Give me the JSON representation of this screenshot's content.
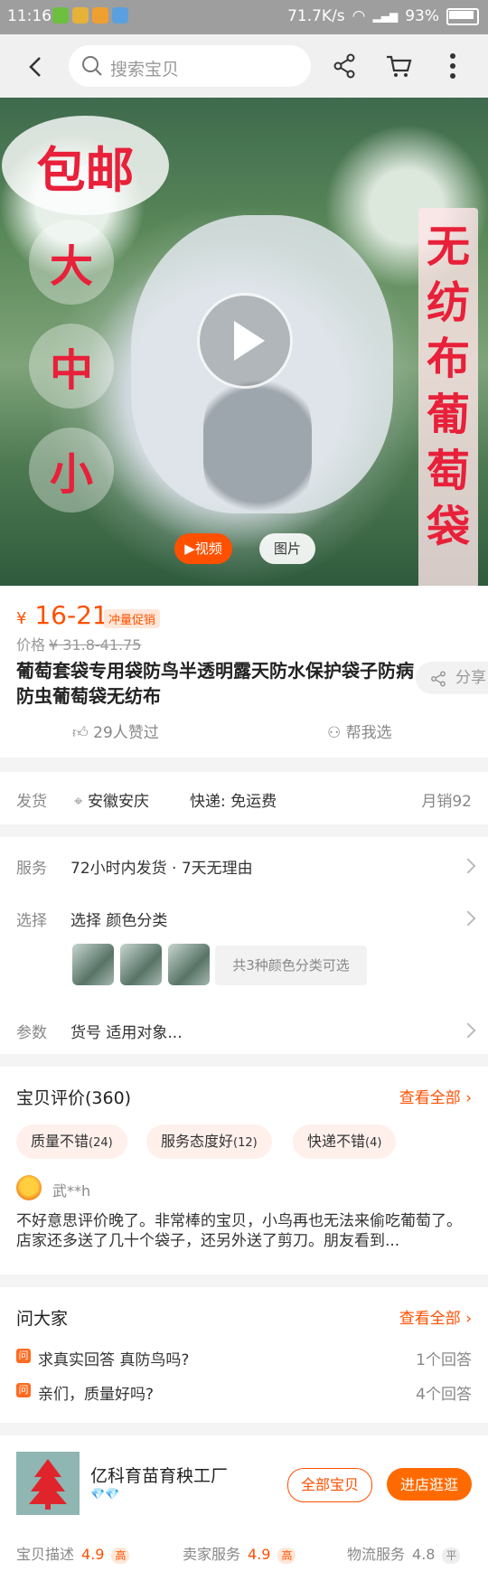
{
  "status": {
    "time": "11:16",
    "network": "71.7K/s",
    "battery": "93%"
  },
  "search": {
    "placeholder": "搜索宝贝"
  },
  "hero": {
    "badge": "包邮",
    "sizes": [
      "大",
      "中",
      "小"
    ],
    "vertical_banner": "无纺布葡萄袋",
    "video_label": "▶视频",
    "pic_label": "图片"
  },
  "product": {
    "price_symbol": "¥",
    "price": "16-21",
    "promo": "冲量促销",
    "old_price_label": "价格",
    "old_price": "¥ 31.8-41.75",
    "title": "葡萄套袋专用袋防鸟半透明露天防水保护袋子防病防虫葡萄袋无纺布",
    "share_label": "分享",
    "likes": "29人赞过",
    "help": "帮我选"
  },
  "shipping": {
    "label": "发货",
    "location": "安徽安庆",
    "express": "快递: 免运费",
    "sales": "月销92"
  },
  "service": {
    "service_label": "服务",
    "service_value": "72小时内发货 · 7天无理由",
    "choose_label": "选择",
    "choose_value": "选择 颜色分类",
    "color_note": "共3种颜色分类可选",
    "param_label": "参数",
    "param_value": "货号 适用对象..."
  },
  "review": {
    "title": "宝贝评价(360)",
    "see_all": "查看全部",
    "tags": [
      {
        "text": "质量不错",
        "count": "(24)"
      },
      {
        "text": "服务态度好",
        "count": "(12)"
      },
      {
        "text": "快递不错",
        "count": "(4)"
      }
    ],
    "reviewer": "武**h",
    "text": "不好意思评价晚了。非常棒的宝贝，小鸟再也无法来偷吃葡萄了。店家还多送了几十个袋子，还另外送了剪刀。朋友看到..."
  },
  "ask": {
    "title": "问大家",
    "see_all": "查看全部",
    "icon": "问",
    "questions": [
      {
        "q": "求真实回答 真防鸟吗?",
        "a": "1个回答"
      },
      {
        "q": "亲们，质量好吗?",
        "a": "4个回答"
      }
    ]
  },
  "shop": {
    "name": "亿科育苗育秧工厂",
    "all_button": "全部宝贝",
    "enter_button": "进店逛逛",
    "scores": [
      {
        "label": "宝贝描述",
        "value": "4.9",
        "level": "高"
      },
      {
        "label": "卖家服务",
        "value": "4.9",
        "level": "高"
      },
      {
        "label": "物流服务",
        "value": "4.8",
        "level": "平"
      }
    ]
  },
  "colors": {
    "accent": "#ff5000",
    "hero_text": "#e8203a"
  }
}
